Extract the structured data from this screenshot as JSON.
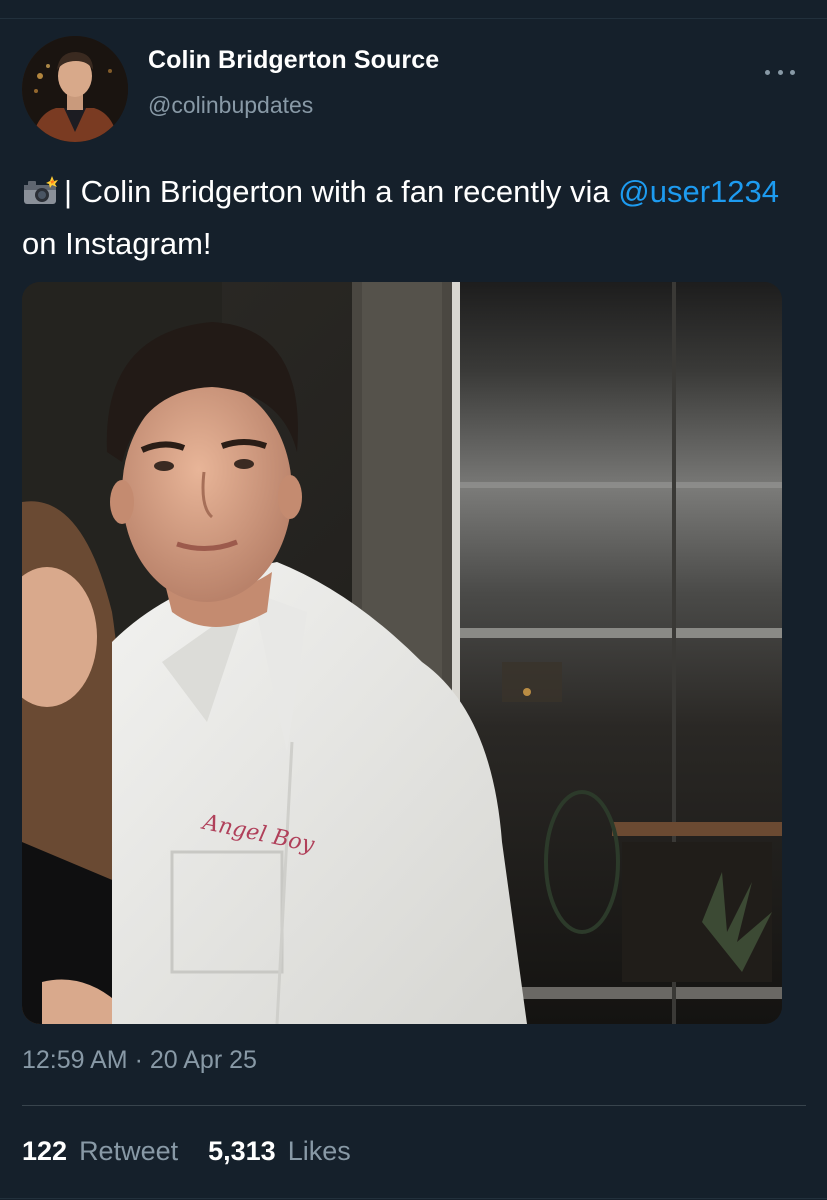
{
  "author": {
    "name": "Colin Bridgerton Source",
    "handle": "@colinbupdates"
  },
  "tweet": {
    "emoji_icon": "camera-with-flash-icon",
    "text_main": "| Colin Bridgerton with a fan recently via",
    "mention": "@user1234",
    "text_after": "on Instagram!",
    "media_caption": "Angel Boy"
  },
  "meta": {
    "time": "12:59 AM",
    "separator": "·",
    "date": "20 Apr 25"
  },
  "stats": {
    "retweets_count": "122",
    "retweets_label": "Retweet",
    "likes_count": "5,313",
    "likes_label": "Likes"
  },
  "colors": {
    "background": "#15202b",
    "link": "#1d9bf0",
    "secondary_text": "#8899a6"
  }
}
